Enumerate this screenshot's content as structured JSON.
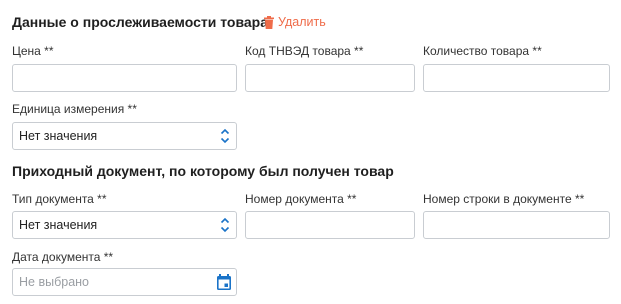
{
  "section1": {
    "title": "Данные о прослеживаемости товара",
    "delete_label": "Удалить",
    "fields": {
      "price_label": "Цена **",
      "tnved_label": "Код ТНВЭД товара **",
      "quantity_label": "Количество товара **",
      "unit_label": "Единица измерения **",
      "unit_value": "Нет значения"
    }
  },
  "section2": {
    "title": "Приходный документ, по которому был получен товар",
    "fields": {
      "doc_type_label": "Тип документа **",
      "doc_type_value": "Нет значения",
      "doc_number_label": "Номер документа **",
      "doc_line_label": "Номер строки в документе **",
      "doc_date_label": "Дата документа **",
      "doc_date_placeholder": "Не выбрано"
    }
  },
  "colors": {
    "delete": "#ef6c4a",
    "calendar_icon": "#1a73c8",
    "chevron": "#1a73c8",
    "border": "#c9cdd2"
  },
  "icons": {
    "delete": "trash-icon",
    "select": "chevron-up-down-icon",
    "date": "calendar-icon"
  }
}
